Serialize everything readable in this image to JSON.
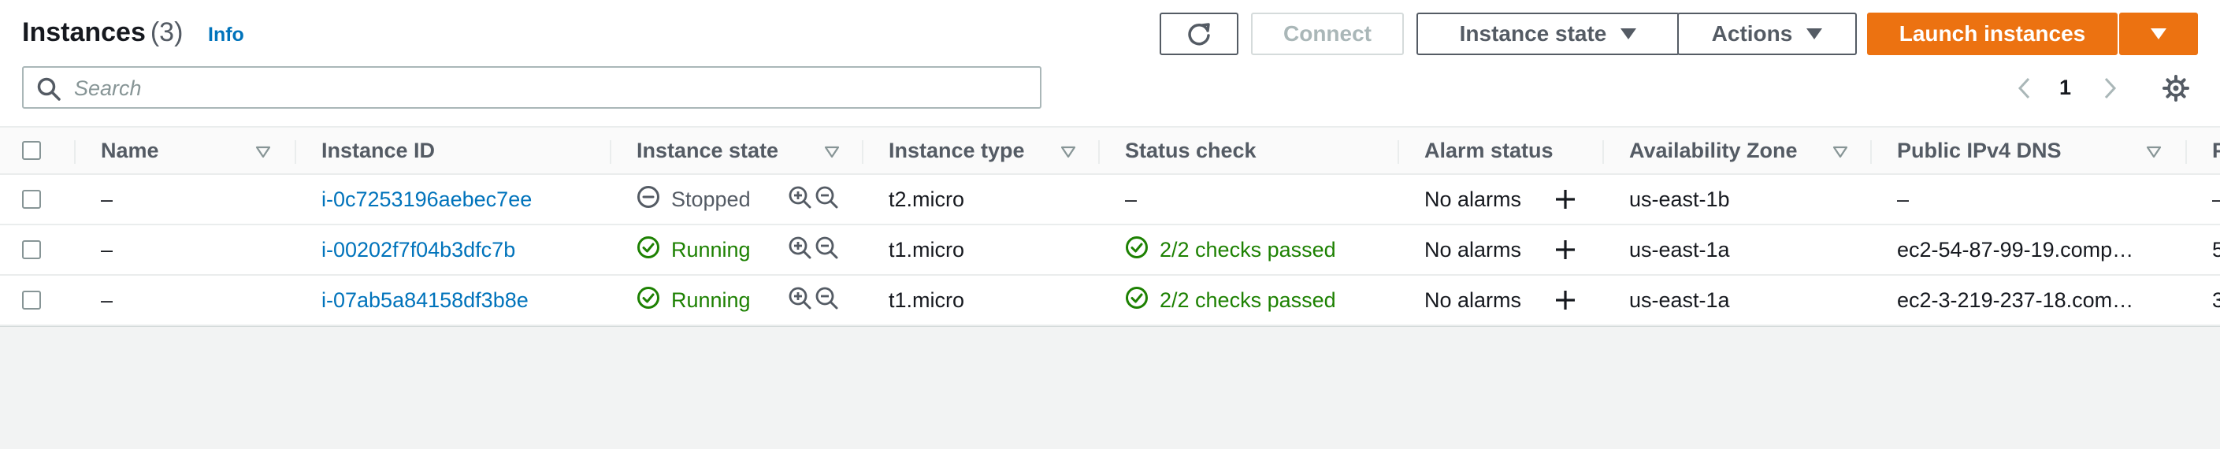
{
  "header": {
    "title": "Instances",
    "count": "(3)",
    "info": "Info"
  },
  "toolbar": {
    "connect_label": "Connect",
    "instance_state_label": "Instance state",
    "actions_label": "Actions",
    "launch_label": "Launch instances"
  },
  "search": {
    "placeholder": "Search",
    "value": ""
  },
  "pagination": {
    "current_page": "1"
  },
  "icons": {
    "refresh": "refresh-icon",
    "search": "search-icon",
    "settings": "gear-icon",
    "stopped": "stopped-circle-icon",
    "running": "check-circle-icon",
    "zoom_in": "zoom-in-icon",
    "zoom_out": "zoom-out-icon",
    "add_alarm": "plus-icon",
    "sort": "sort-caret-icon"
  },
  "colors": {
    "primary": "#ec7211",
    "link": "#0073bb",
    "success": "#1d8102",
    "neutral": "#545b64"
  },
  "table": {
    "columns": [
      {
        "label": "Name"
      },
      {
        "label": "Instance ID"
      },
      {
        "label": "Instance state"
      },
      {
        "label": "Instance type"
      },
      {
        "label": "Status check"
      },
      {
        "label": "Alarm status"
      },
      {
        "label": "Availability Zone"
      },
      {
        "label": "Public IPv4 DNS"
      },
      {
        "label": "P"
      }
    ],
    "rows": [
      {
        "name": "–",
        "instance_id": "i-0c7253196aebec7ee",
        "state": "Stopped",
        "state_kind": "stopped",
        "type": "t2.micro",
        "status_check": "–",
        "status_ok": false,
        "alarm": "No alarms",
        "zone": "us-east-1b",
        "dns": "–",
        "next": "–"
      },
      {
        "name": "–",
        "instance_id": "i-00202f7f04b3dfc7b",
        "state": "Running",
        "state_kind": "running",
        "type": "t1.micro",
        "status_check": "2/2 checks passed",
        "status_ok": true,
        "alarm": "No alarms",
        "zone": "us-east-1a",
        "dns": "ec2-54-87-99-19.comp…",
        "next": "5"
      },
      {
        "name": "–",
        "instance_id": "i-07ab5a84158df3b8e",
        "state": "Running",
        "state_kind": "running",
        "type": "t1.micro",
        "status_check": "2/2 checks passed",
        "status_ok": true,
        "alarm": "No alarms",
        "zone": "us-east-1a",
        "dns": "ec2-3-219-237-18.com…",
        "next": "3"
      }
    ]
  }
}
